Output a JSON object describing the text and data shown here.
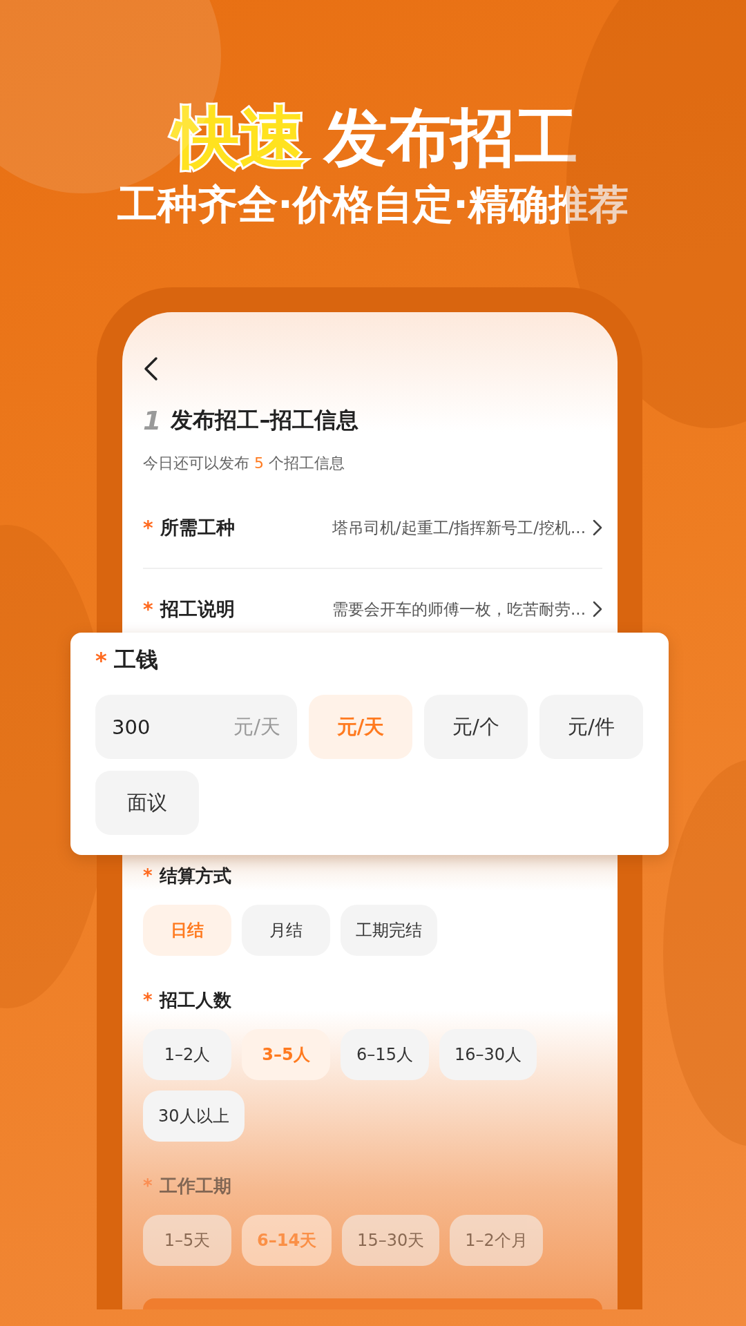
{
  "headline": {
    "highlight": "快速",
    "title": "发布招工"
  },
  "subtitle": "工种齐全·价格自定·精确推荐",
  "screen": {
    "step": "1",
    "title": "发布招工–招工信息",
    "quota": {
      "before": "今日还可以发布",
      "count": "5",
      "after": "个招工信息"
    },
    "rows": [
      {
        "mark": "*",
        "label": "所需工种",
        "value": "塔吊司机/起重工/指挥新号工/挖机..."
      },
      {
        "mark": "*",
        "label": "招工说明",
        "value": "需要会开车的师傅一枚，吃苦耐劳..."
      }
    ],
    "wage": {
      "mark": "*",
      "label": "工钱",
      "value": "300",
      "unit": "元/天",
      "options": [
        {
          "label": "元/天",
          "selected": true
        },
        {
          "label": "元/个",
          "selected": false
        },
        {
          "label": "元/件",
          "selected": false
        },
        {
          "label": "面议",
          "selected": false
        }
      ]
    },
    "sections": [
      {
        "mark": "*",
        "label": "结算方式",
        "options": [
          {
            "label": "日结",
            "selected": true
          },
          {
            "label": "月结",
            "selected": false
          },
          {
            "label": "工期完结",
            "selected": false
          }
        ]
      },
      {
        "mark": "*",
        "label": "招工人数",
        "options": [
          {
            "label": "1–2人",
            "selected": false
          },
          {
            "label": "3–5人",
            "selected": true
          },
          {
            "label": "6–15人",
            "selected": false
          },
          {
            "label": "16–30人",
            "selected": false
          },
          {
            "label": "30人以上",
            "selected": false
          }
        ]
      },
      {
        "mark": "*",
        "label": "工作工期",
        "options": [
          {
            "label": "1–5天",
            "selected": false
          },
          {
            "label": "6–14天",
            "selected": true
          },
          {
            "label": "15–30天",
            "selected": false
          },
          {
            "label": "1–2个月",
            "selected": false
          }
        ]
      }
    ]
  }
}
